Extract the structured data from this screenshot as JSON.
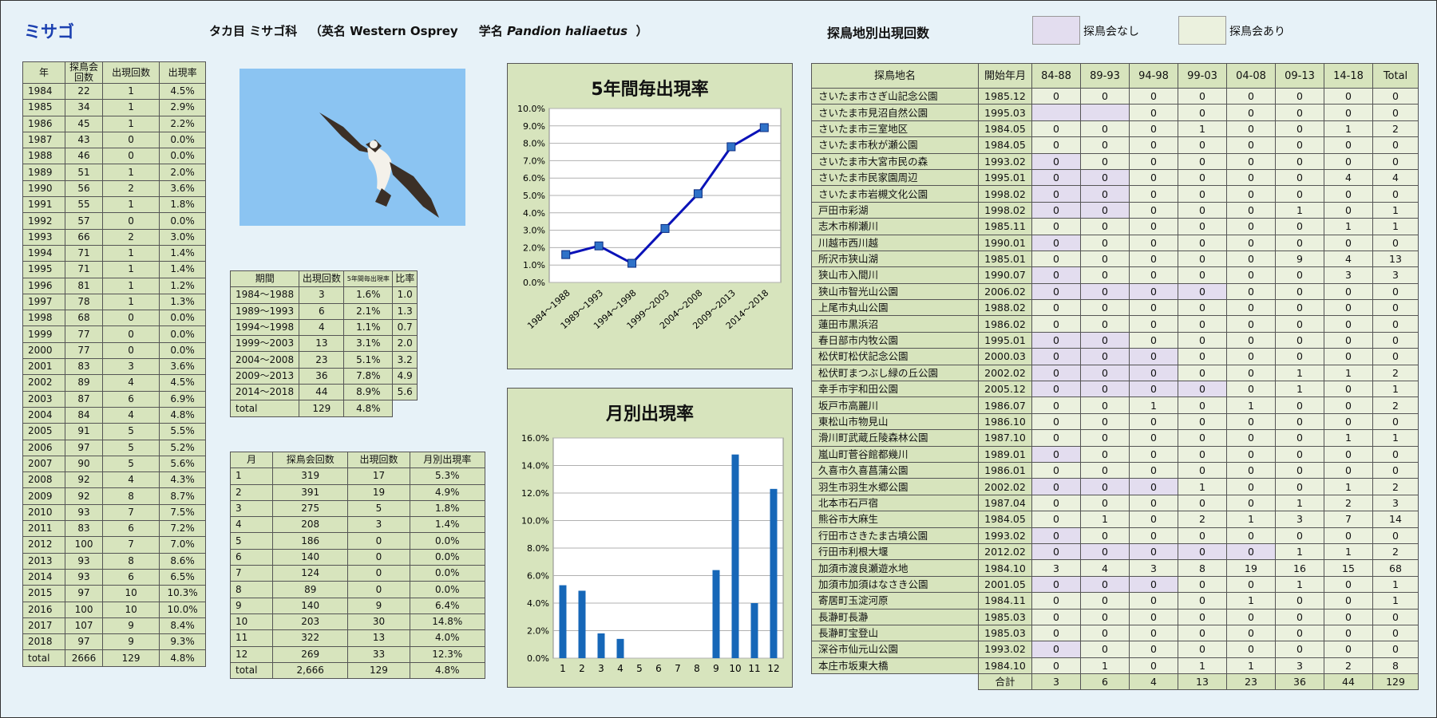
{
  "title": "ミサゴ",
  "subtitle": {
    "order_family": "タカ目 ミサゴ科",
    "en_prefix": "（英名 Western Osprey",
    "sci_prefix": "学名",
    "sci_name": "Pandion haliaetus",
    "close": "）"
  },
  "location_title": "探鳥地別出現回数",
  "legend": {
    "no_meeting": "探鳥会なし",
    "meeting": "探鳥会あり",
    "no_meeting_color": "#e3ddef",
    "meeting_color": "#ebf1de"
  },
  "photo": {
    "icon": "osprey-bird-icon"
  },
  "yearly": {
    "headers": [
      "年",
      "探鳥会回数",
      "出現回数",
      "出現率"
    ],
    "rows": [
      [
        "1984",
        "22",
        "1",
        "4.5%"
      ],
      [
        "1985",
        "34",
        "1",
        "2.9%"
      ],
      [
        "1986",
        "45",
        "1",
        "2.2%"
      ],
      [
        "1987",
        "43",
        "0",
        "0.0%"
      ],
      [
        "1988",
        "46",
        "0",
        "0.0%"
      ],
      [
        "1989",
        "51",
        "1",
        "2.0%"
      ],
      [
        "1990",
        "56",
        "2",
        "3.6%"
      ],
      [
        "1991",
        "55",
        "1",
        "1.8%"
      ],
      [
        "1992",
        "57",
        "0",
        "0.0%"
      ],
      [
        "1993",
        "66",
        "2",
        "3.0%"
      ],
      [
        "1994",
        "71",
        "1",
        "1.4%"
      ],
      [
        "1995",
        "71",
        "1",
        "1.4%"
      ],
      [
        "1996",
        "81",
        "1",
        "1.2%"
      ],
      [
        "1997",
        "78",
        "1",
        "1.3%"
      ],
      [
        "1998",
        "68",
        "0",
        "0.0%"
      ],
      [
        "1999",
        "77",
        "0",
        "0.0%"
      ],
      [
        "2000",
        "77",
        "0",
        "0.0%"
      ],
      [
        "2001",
        "83",
        "3",
        "3.6%"
      ],
      [
        "2002",
        "89",
        "4",
        "4.5%"
      ],
      [
        "2003",
        "87",
        "6",
        "6.9%"
      ],
      [
        "2004",
        "84",
        "4",
        "4.8%"
      ],
      [
        "2005",
        "91",
        "5",
        "5.5%"
      ],
      [
        "2006",
        "97",
        "5",
        "5.2%"
      ],
      [
        "2007",
        "90",
        "5",
        "5.6%"
      ],
      [
        "2008",
        "92",
        "4",
        "4.3%"
      ],
      [
        "2009",
        "92",
        "8",
        "8.7%"
      ],
      [
        "2010",
        "93",
        "7",
        "7.5%"
      ],
      [
        "2011",
        "83",
        "6",
        "7.2%"
      ],
      [
        "2012",
        "100",
        "7",
        "7.0%"
      ],
      [
        "2013",
        "93",
        "8",
        "8.6%"
      ],
      [
        "2014",
        "93",
        "6",
        "6.5%"
      ],
      [
        "2015",
        "97",
        "10",
        "10.3%"
      ],
      [
        "2016",
        "100",
        "10",
        "10.0%"
      ],
      [
        "2017",
        "107",
        "9",
        "8.4%"
      ],
      [
        "2018",
        "97",
        "9",
        "9.3%"
      ],
      [
        "total",
        "2666",
        "129",
        "4.8%"
      ]
    ]
  },
  "period": {
    "headers": [
      "期間",
      "出現回数",
      "5年間毎出現率",
      "比率"
    ],
    "rows": [
      [
        "1984～1988",
        "3",
        "1.6%",
        "1.0"
      ],
      [
        "1989～1993",
        "6",
        "2.1%",
        "1.3"
      ],
      [
        "1994～1998",
        "4",
        "1.1%",
        "0.7"
      ],
      [
        "1999～2003",
        "13",
        "3.1%",
        "2.0"
      ],
      [
        "2004～2008",
        "23",
        "5.1%",
        "3.2"
      ],
      [
        "2009～2013",
        "36",
        "7.8%",
        "4.9"
      ],
      [
        "2014～2018",
        "44",
        "8.9%",
        "5.6"
      ],
      [
        "total",
        "129",
        "4.8%",
        ""
      ]
    ]
  },
  "monthly": {
    "headers": [
      "月",
      "探鳥会回数",
      "出現回数",
      "月別出現率"
    ],
    "rows": [
      [
        "1",
        "319",
        "17",
        "5.3%"
      ],
      [
        "2",
        "391",
        "19",
        "4.9%"
      ],
      [
        "3",
        "275",
        "5",
        "1.8%"
      ],
      [
        "4",
        "208",
        "3",
        "1.4%"
      ],
      [
        "5",
        "186",
        "0",
        "0.0%"
      ],
      [
        "6",
        "140",
        "0",
        "0.0%"
      ],
      [
        "7",
        "124",
        "0",
        "0.0%"
      ],
      [
        "8",
        "89",
        "0",
        "0.0%"
      ],
      [
        "9",
        "140",
        "9",
        "6.4%"
      ],
      [
        "10",
        "203",
        "30",
        "14.8%"
      ],
      [
        "11",
        "322",
        "13",
        "4.0%"
      ],
      [
        "12",
        "269",
        "33",
        "12.3%"
      ],
      [
        "total",
        "2,666",
        "129",
        "4.8%"
      ]
    ]
  },
  "chart_data": [
    {
      "type": "line",
      "title": "5年間毎出現率",
      "categories": [
        "1984～1988",
        "1989～1993",
        "1994～1998",
        "1999～2003",
        "2004～2008",
        "2009～2013",
        "2014～2018"
      ],
      "values": [
        1.6,
        2.1,
        1.1,
        3.1,
        5.1,
        7.8,
        8.9
      ],
      "ylim": [
        0,
        10
      ],
      "yticks": [
        "0.0%",
        "1.0%",
        "2.0%",
        "3.0%",
        "4.0%",
        "5.0%",
        "6.0%",
        "7.0%",
        "8.0%",
        "9.0%",
        "10.0%"
      ],
      "grid": true,
      "color": "#0a12b8"
    },
    {
      "type": "bar",
      "title": "月別出現率",
      "categories": [
        "1",
        "2",
        "3",
        "4",
        "5",
        "6",
        "7",
        "8",
        "9",
        "10",
        "11",
        "12"
      ],
      "values": [
        5.3,
        4.9,
        1.8,
        1.4,
        0,
        0,
        0,
        0,
        6.4,
        14.8,
        4.0,
        12.3
      ],
      "ylim": [
        0,
        16
      ],
      "yticks": [
        "0.0%",
        "2.0%",
        "4.0%",
        "6.0%",
        "8.0%",
        "10.0%",
        "12.0%",
        "14.0%",
        "16.0%"
      ],
      "grid": true,
      "color": "#1667b8"
    }
  ],
  "locations": {
    "headers": [
      "探鳥地名",
      "開始年月",
      "84-88",
      "89-93",
      "94-98",
      "99-03",
      "04-08",
      "09-13",
      "14-18",
      "Total"
    ],
    "rows": [
      {
        "name": "さいたま市さぎ山記念公園",
        "start": "1985.12",
        "v": [
          "0",
          "0",
          "0",
          "0",
          "0",
          "0",
          "0"
        ],
        "pre": 0,
        "total": "0"
      },
      {
        "name": "さいたま市見沼自然公園",
        "start": "1995.03",
        "v": [
          "",
          "",
          "0",
          "0",
          "0",
          "0",
          "0"
        ],
        "pre": 2,
        "total": "0"
      },
      {
        "name": "さいたま市三室地区",
        "start": "1984.05",
        "v": [
          "0",
          "0",
          "0",
          "1",
          "0",
          "0",
          "1"
        ],
        "pre": 0,
        "total": "2"
      },
      {
        "name": "さいたま市秋が瀬公園",
        "start": "1984.05",
        "v": [
          "0",
          "0",
          "0",
          "0",
          "0",
          "0",
          "0"
        ],
        "pre": 0,
        "total": "0"
      },
      {
        "name": "さいたま市大宮市民の森",
        "start": "1993.02",
        "v": [
          "0",
          "0",
          "0",
          "0",
          "0",
          "0",
          "0"
        ],
        "pre": 1,
        "total": "0"
      },
      {
        "name": "さいたま市民家園周辺",
        "start": "1995.01",
        "v": [
          "0",
          "0",
          "0",
          "0",
          "0",
          "0",
          "4"
        ],
        "pre": 2,
        "total": "4"
      },
      {
        "name": "さいたま市岩槻文化公園",
        "start": "1998.02",
        "v": [
          "0",
          "0",
          "0",
          "0",
          "0",
          "0",
          "0"
        ],
        "pre": 2,
        "total": "0"
      },
      {
        "name": "戸田市彩湖",
        "start": "1998.02",
        "v": [
          "0",
          "0",
          "0",
          "0",
          "0",
          "1",
          "0"
        ],
        "pre": 2,
        "total": "1"
      },
      {
        "name": "志木市柳瀬川",
        "start": "1985.11",
        "v": [
          "0",
          "0",
          "0",
          "0",
          "0",
          "0",
          "1"
        ],
        "pre": 0,
        "total": "1"
      },
      {
        "name": "川越市西川越",
        "start": "1990.01",
        "v": [
          "0",
          "0",
          "0",
          "0",
          "0",
          "0",
          "0"
        ],
        "pre": 1,
        "total": "0"
      },
      {
        "name": "所沢市狭山湖",
        "start": "1985.01",
        "v": [
          "0",
          "0",
          "0",
          "0",
          "0",
          "9",
          "4"
        ],
        "pre": 0,
        "total": "13"
      },
      {
        "name": "狭山市入間川",
        "start": "1990.07",
        "v": [
          "0",
          "0",
          "0",
          "0",
          "0",
          "0",
          "3"
        ],
        "pre": 1,
        "total": "3"
      },
      {
        "name": "狭山市智光山公園",
        "start": "2006.02",
        "v": [
          "0",
          "0",
          "0",
          "0",
          "0",
          "0",
          "0"
        ],
        "pre": 4,
        "total": "0"
      },
      {
        "name": "上尾市丸山公園",
        "start": "1988.02",
        "v": [
          "0",
          "0",
          "0",
          "0",
          "0",
          "0",
          "0"
        ],
        "pre": 0,
        "total": "0"
      },
      {
        "name": "蓮田市黒浜沼",
        "start": "1986.02",
        "v": [
          "0",
          "0",
          "0",
          "0",
          "0",
          "0",
          "0"
        ],
        "pre": 0,
        "total": "0"
      },
      {
        "name": "春日部市内牧公園",
        "start": "1995.01",
        "v": [
          "0",
          "0",
          "0",
          "0",
          "0",
          "0",
          "0"
        ],
        "pre": 2,
        "total": "0"
      },
      {
        "name": "松伏町松伏記念公園",
        "start": "2000.03",
        "v": [
          "0",
          "0",
          "0",
          "0",
          "0",
          "0",
          "0"
        ],
        "pre": 3,
        "total": "0"
      },
      {
        "name": "松伏町まつぶし緑の丘公園",
        "start": "2002.02",
        "v": [
          "0",
          "0",
          "0",
          "0",
          "0",
          "1",
          "1"
        ],
        "pre": 3,
        "total": "2"
      },
      {
        "name": "幸手市宇和田公園",
        "start": "2005.12",
        "v": [
          "0",
          "0",
          "0",
          "0",
          "0",
          "1",
          "0"
        ],
        "pre": 4,
        "total": "1"
      },
      {
        "name": "坂戸市高麗川",
        "start": "1986.07",
        "v": [
          "0",
          "0",
          "1",
          "0",
          "1",
          "0",
          "0"
        ],
        "pre": 0,
        "total": "2"
      },
      {
        "name": "東松山市物見山",
        "start": "1986.10",
        "v": [
          "0",
          "0",
          "0",
          "0",
          "0",
          "0",
          "0"
        ],
        "pre": 0,
        "total": "0"
      },
      {
        "name": "滑川町武蔵丘陵森林公園",
        "start": "1987.10",
        "v": [
          "0",
          "0",
          "0",
          "0",
          "0",
          "0",
          "1"
        ],
        "pre": 0,
        "total": "1"
      },
      {
        "name": "嵐山町菅谷館都幾川",
        "start": "1989.01",
        "v": [
          "0",
          "0",
          "0",
          "0",
          "0",
          "0",
          "0"
        ],
        "pre": 1,
        "total": "0"
      },
      {
        "name": "久喜市久喜菖蒲公園",
        "start": "1986.01",
        "v": [
          "0",
          "0",
          "0",
          "0",
          "0",
          "0",
          "0"
        ],
        "pre": 0,
        "total": "0"
      },
      {
        "name": "羽生市羽生水郷公園",
        "start": "2002.02",
        "v": [
          "0",
          "0",
          "0",
          "1",
          "0",
          "0",
          "1"
        ],
        "pre": 3,
        "total": "2"
      },
      {
        "name": "北本市石戸宿",
        "start": "1987.04",
        "v": [
          "0",
          "0",
          "0",
          "0",
          "0",
          "1",
          "2"
        ],
        "pre": 0,
        "total": "3"
      },
      {
        "name": "熊谷市大麻生",
        "start": "1984.05",
        "v": [
          "0",
          "1",
          "0",
          "2",
          "1",
          "3",
          "7"
        ],
        "pre": 0,
        "total": "14"
      },
      {
        "name": "行田市さきたま古墳公園",
        "start": "1993.02",
        "v": [
          "0",
          "0",
          "0",
          "0",
          "0",
          "0",
          "0"
        ],
        "pre": 1,
        "total": "0"
      },
      {
        "name": "行田市利根大堰",
        "start": "2012.02",
        "v": [
          "0",
          "0",
          "0",
          "0",
          "0",
          "1",
          "1"
        ],
        "pre": 5,
        "total": "2"
      },
      {
        "name": "加須市渡良瀬遊水地",
        "start": "1984.10",
        "v": [
          "3",
          "4",
          "3",
          "8",
          "19",
          "16",
          "15"
        ],
        "pre": 0,
        "total": "68"
      },
      {
        "name": "加須市加須はなさき公園",
        "start": "2001.05",
        "v": [
          "0",
          "0",
          "0",
          "0",
          "0",
          "1",
          "0"
        ],
        "pre": 3,
        "total": "1"
      },
      {
        "name": "寄居町玉淀河原",
        "start": "1984.11",
        "v": [
          "0",
          "0",
          "0",
          "0",
          "1",
          "0",
          "0"
        ],
        "pre": 0,
        "total": "1"
      },
      {
        "name": "長瀞町長瀞",
        "start": "1985.03",
        "v": [
          "0",
          "0",
          "0",
          "0",
          "0",
          "0",
          "0"
        ],
        "pre": 0,
        "total": "0"
      },
      {
        "name": "長瀞町宝登山",
        "start": "1985.03",
        "v": [
          "0",
          "0",
          "0",
          "0",
          "0",
          "0",
          "0"
        ],
        "pre": 0,
        "total": "0"
      },
      {
        "name": "深谷市仙元山公園",
        "start": "1993.02",
        "v": [
          "0",
          "0",
          "0",
          "0",
          "0",
          "0",
          "0"
        ],
        "pre": 1,
        "total": "0"
      },
      {
        "name": "本庄市坂東大橋",
        "start": "1984.10",
        "v": [
          "0",
          "1",
          "0",
          "1",
          "1",
          "3",
          "2"
        ],
        "pre": 0,
        "total": "8"
      }
    ],
    "sum_label": "合計",
    "sum": [
      "3",
      "6",
      "4",
      "13",
      "23",
      "36",
      "44",
      "129"
    ]
  }
}
